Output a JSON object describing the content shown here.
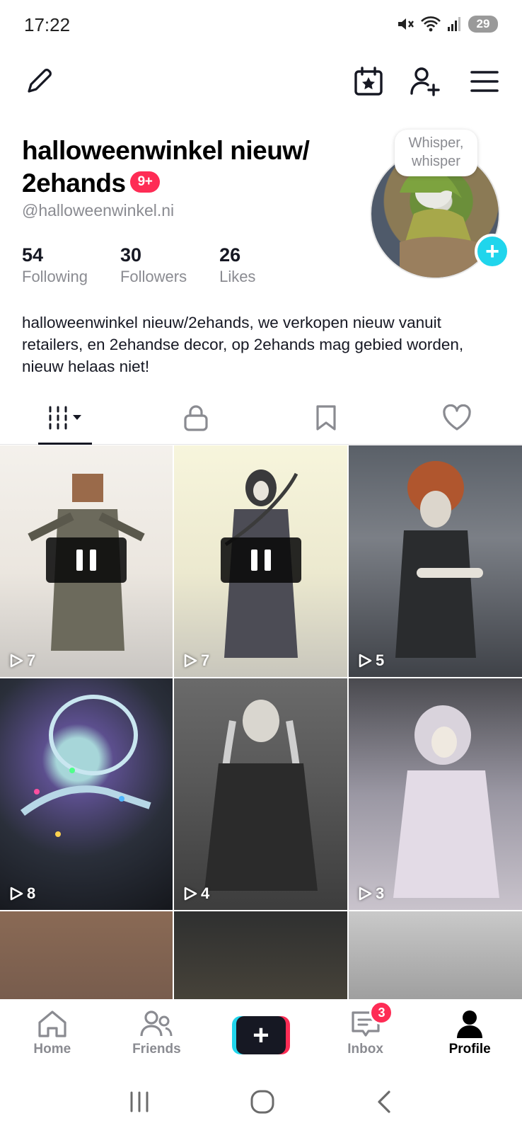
{
  "status_bar": {
    "time": "17:22",
    "battery": "29",
    "icons": [
      "mute-icon",
      "wifi-icon",
      "signal-icon",
      "battery-icon"
    ]
  },
  "top_nav": {
    "icons": [
      "pencil-icon",
      "calendar-star-icon",
      "add-user-icon",
      "menu-icon"
    ]
  },
  "profile": {
    "display_name": "halloweenwinkel nieuw/ 2ehands",
    "notification_badge": "9+",
    "username": "@halloweenwinkel.ni",
    "status_bubble": "Whisper, whisper",
    "stats": [
      {
        "value": "54",
        "label": "Following"
      },
      {
        "value": "30",
        "label": "Followers"
      },
      {
        "value": "26",
        "label": "Likes"
      }
    ],
    "bio": "halloweenwinkel nieuw/2ehands, we verkopen nieuw vanuit retailers, en 2ehandse decor, op 2ehands mag gebied worden, nieuw helaas niet!"
  },
  "tabs": [
    {
      "name": "videos",
      "icon": "grid-dropdown-icon",
      "active": true
    },
    {
      "name": "private",
      "icon": "lock-icon",
      "active": false
    },
    {
      "name": "saved",
      "icon": "bookmark-icon",
      "active": false
    },
    {
      "name": "liked",
      "icon": "heart-icon",
      "active": false
    }
  ],
  "videos": [
    {
      "views": "7",
      "paused": true
    },
    {
      "views": "7",
      "paused": true
    },
    {
      "views": "5",
      "paused": false
    },
    {
      "views": "8",
      "paused": false
    },
    {
      "views": "4",
      "paused": false
    },
    {
      "views": "3",
      "paused": false
    },
    {
      "views": "",
      "paused": false
    },
    {
      "views": "",
      "paused": false
    },
    {
      "views": "",
      "paused": false
    }
  ],
  "bottom_nav": {
    "home": "Home",
    "friends": "Friends",
    "create": "+",
    "inbox": "Inbox",
    "inbox_badge": "3",
    "profile": "Profile"
  },
  "colors": {
    "accent_red": "#fe2c55",
    "accent_cyan": "#20d5ec",
    "text_primary": "#161823",
    "text_secondary": "#8a8b91"
  }
}
